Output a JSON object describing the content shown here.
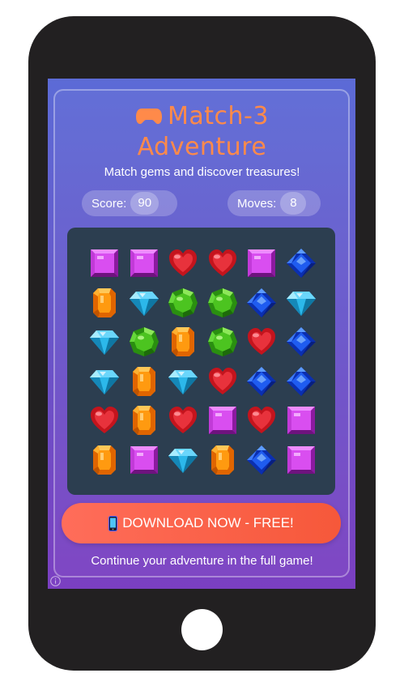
{
  "header": {
    "title_line1": "Match-3",
    "title_line2": "Adventure",
    "title_icon": "gamepad-icon",
    "subtitle": "Match gems and discover treasures!"
  },
  "stats": {
    "score_label": "Score:",
    "score_value": "90",
    "moves_label": "Moves:",
    "moves_value": "8"
  },
  "board": {
    "rows": 6,
    "cols": 6,
    "grid": [
      [
        "purple",
        "purple",
        "red",
        "red",
        "purple",
        "blue"
      ],
      [
        "orange",
        "cyan",
        "green",
        "green",
        "blue",
        "cyan"
      ],
      [
        "cyan",
        "green",
        "orange",
        "green",
        "red",
        "blue"
      ],
      [
        "cyan",
        "orange",
        "cyan",
        "red",
        "blue",
        "blue"
      ],
      [
        "red",
        "orange",
        "red",
        "purple",
        "red",
        "purple"
      ],
      [
        "orange",
        "purple",
        "cyan",
        "orange",
        "blue",
        "purple"
      ]
    ]
  },
  "cta": {
    "label": "DOWNLOAD NOW - FREE!",
    "icon": "mobile-phone-icon"
  },
  "footer": {
    "text": "Continue your adventure in the full game!"
  },
  "colors": {
    "title": "#ff8a4a",
    "board_bg": "#2c3e50",
    "cta_bg": "#f6583a",
    "phone_body": "#222021"
  }
}
